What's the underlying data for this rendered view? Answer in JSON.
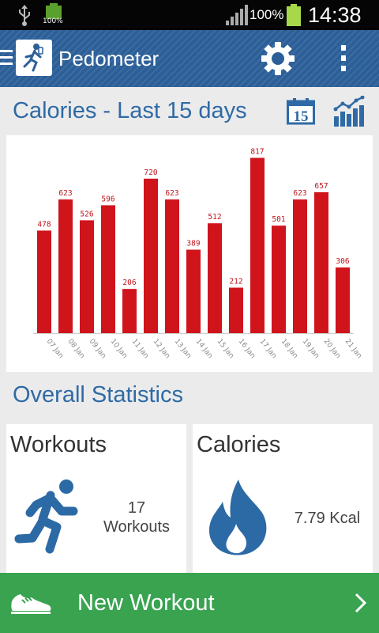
{
  "statusbar": {
    "small_battery_label": "100%",
    "battery_percent": "100%",
    "time": "14:38"
  },
  "actionbar": {
    "title": "Pedometer",
    "icons": [
      "menu-icon",
      "app-logo",
      "gear-icon",
      "overflow-icon"
    ]
  },
  "calories_section": {
    "title": "Calories - Last 15 days",
    "icons": [
      "calendar-icon",
      "trend-chart-icon"
    ],
    "calendar_number": "15"
  },
  "chart_data": {
    "type": "bar",
    "categories": [
      "07 Jan",
      "08 Jan",
      "09 Jan",
      "10 Jan",
      "11 Jan",
      "12 Jan",
      "13 Jan",
      "14 Jan",
      "15 Jan",
      "16 Jan",
      "17 Jan",
      "18 Jan",
      "19 Jan",
      "20 Jan",
      "21 Jan"
    ],
    "values": [
      478,
      623,
      526,
      596,
      206,
      720,
      623,
      389,
      512,
      212,
      817,
      501,
      623,
      657,
      306
    ],
    "ylim": [
      0,
      900
    ],
    "bar_color": "#d0141c",
    "label_color": "#c0141c",
    "grid": false,
    "legend": "none"
  },
  "overall": {
    "title": "Overall Statistics",
    "workouts": {
      "title": "Workouts",
      "count": "17",
      "unit": "Workouts",
      "icon": "runner-icon"
    },
    "calories": {
      "title": "Calories",
      "value": "7.79 Kcal",
      "icon": "flame-icon"
    }
  },
  "new_workout": {
    "label": "New Workout",
    "icons": [
      "shoe-icon",
      "chevron-right-icon"
    ]
  },
  "colors": {
    "accent": "#2f6aa6",
    "actionbar": "#2c5f98",
    "button": "#39a350",
    "bars": "#d0141c"
  }
}
